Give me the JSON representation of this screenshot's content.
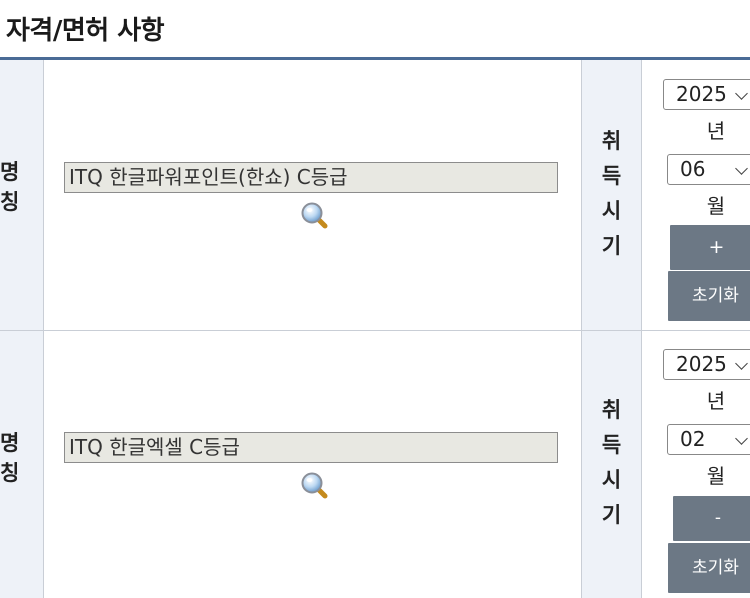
{
  "section_title": "자격/면허 사항",
  "rows": [
    {
      "name_header": "명\n칭",
      "name_value": "ITQ 한글파워포인트(한쇼) C등급",
      "acquired_header": "취\n득\n시\n기",
      "year": "2025",
      "year_unit": "년",
      "month": "06",
      "month_unit": "월",
      "action_button": "+",
      "reset_button": "초기화"
    },
    {
      "name_header": "명\n칭",
      "name_value": "ITQ 한글엑셀 C등급",
      "acquired_header": "취\n득\n시\n기",
      "year": "2025",
      "year_unit": "년",
      "month": "02",
      "month_unit": "월",
      "action_button": "-",
      "reset_button": "초기화"
    }
  ],
  "colors": {
    "title_line": "#4a6b96",
    "header_bg": "#eef2f8",
    "button_bg": "#6c7885",
    "field_bg": "#e8e8e2"
  },
  "icons": {
    "search": "magnifier-icon"
  }
}
